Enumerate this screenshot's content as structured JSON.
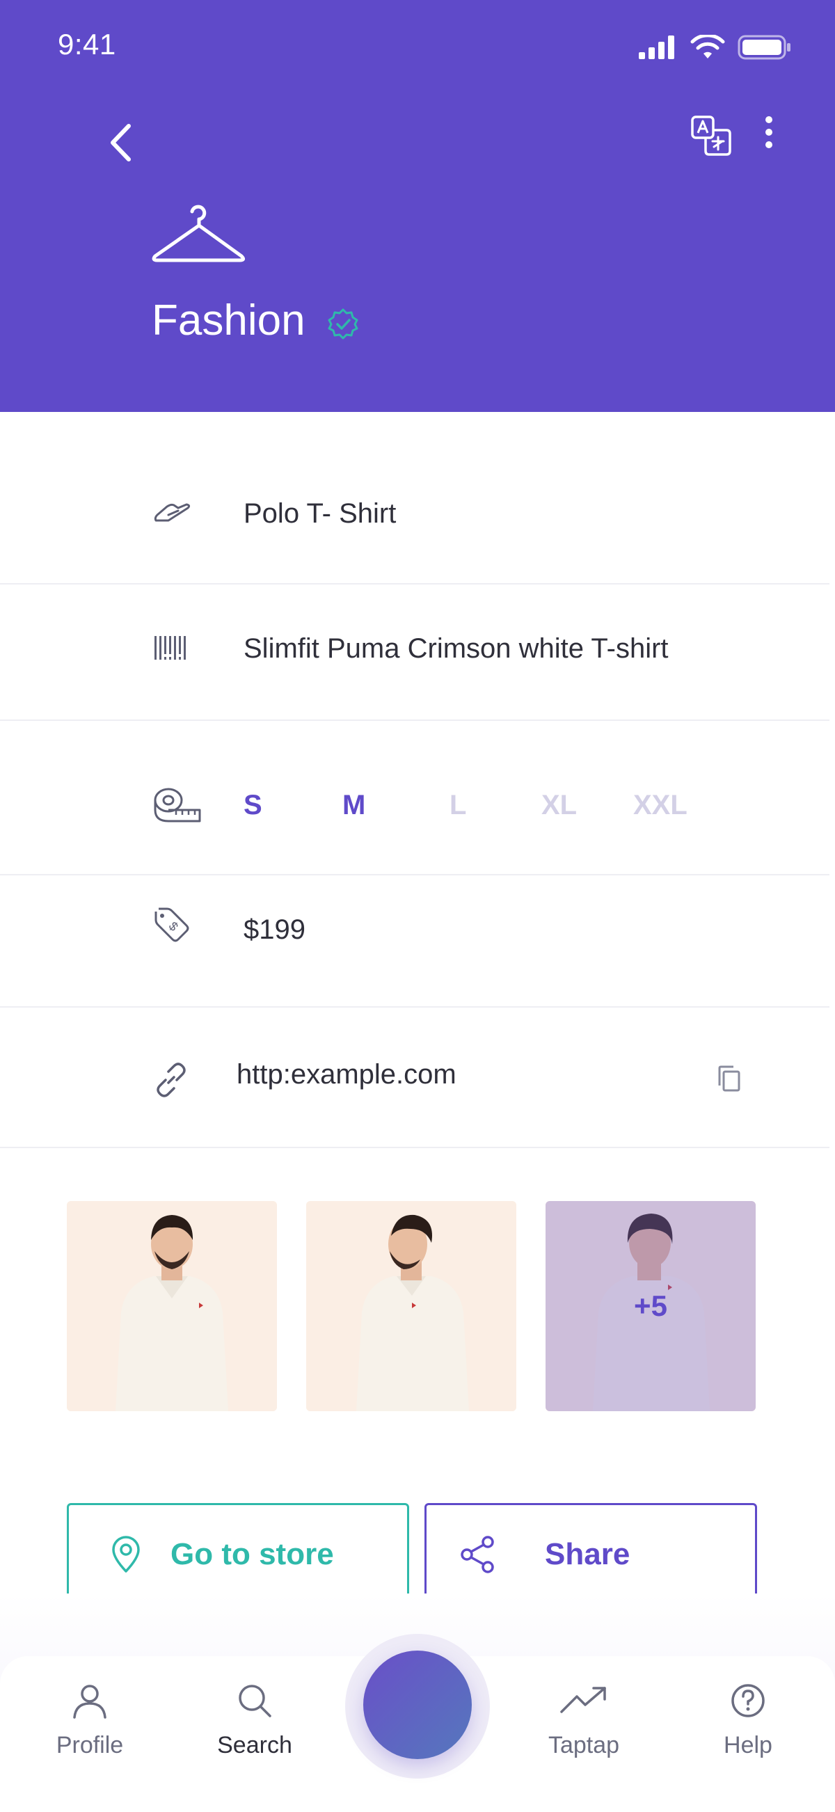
{
  "status_bar": {
    "time": "9:41"
  },
  "header": {
    "title": "Fashion",
    "background": "#5f4ac9"
  },
  "details": {
    "name": "Polo T- Shirt",
    "description": "Slimfit Puma Crimson white T-shirt",
    "sizes": [
      {
        "label": "S",
        "available": true
      },
      {
        "label": "M",
        "available": true
      },
      {
        "label": "L",
        "available": false
      },
      {
        "label": "XL",
        "available": false
      },
      {
        "label": "XXL",
        "available": false
      }
    ],
    "price": "$199",
    "link": "http:example.com"
  },
  "gallery": {
    "more_count": "+5"
  },
  "actions": {
    "store_label": "Go to store",
    "share_label": "Share"
  },
  "nav": {
    "items": [
      {
        "label": "Profile",
        "icon": "user-icon"
      },
      {
        "label": "Search",
        "icon": "search-icon"
      },
      {
        "label": "Taptap",
        "icon": "trending-icon"
      },
      {
        "label": "Help",
        "icon": "help-icon"
      }
    ]
  },
  "colors": {
    "accent": "#5f4ac9",
    "teal": "#2fb9aa",
    "inactive": "#d3d0e6"
  }
}
